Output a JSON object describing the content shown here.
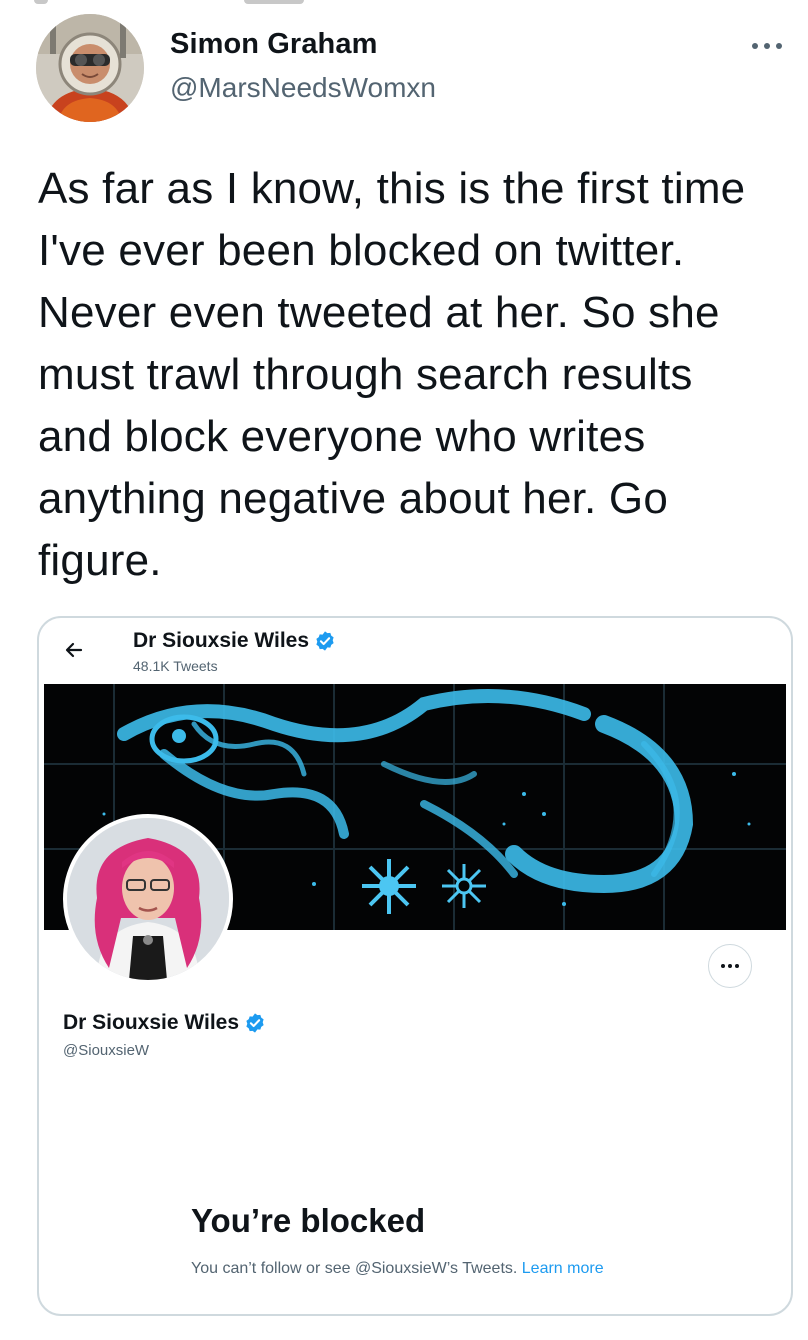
{
  "tweet": {
    "author_name": "Simon Graham",
    "author_handle": "@MarsNeedsWomxn",
    "text": "As far as I know, this is the first time I've ever been blocked on twitter. Never even tweeted at her. So she must trawl through search results and block everyone who writes anything negative about her. Go figure."
  },
  "embedded_profile": {
    "header_name": "Dr Siouxsie Wiles",
    "tweet_count": "48.1K Tweets",
    "name": "Dr Siouxsie Wiles",
    "handle": "@SiouxsieW",
    "blocked_title": "You’re blocked",
    "blocked_text": "You can’t follow or see @SiouxsieW’s Tweets.",
    "learn_more_label": "Learn more"
  },
  "icons": {
    "more": "more-horizontal-icon",
    "back": "arrow-left-icon",
    "verified": "verified-badge-icon"
  },
  "colors": {
    "text_primary": "#0f1419",
    "text_secondary": "#536471",
    "link": "#1d9bf0",
    "verified": "#1d9bf0",
    "border": "#cfd9de",
    "banner_glow": "#33b6e6"
  }
}
